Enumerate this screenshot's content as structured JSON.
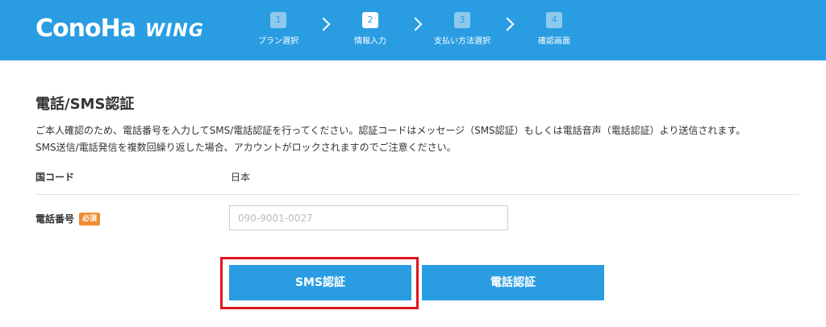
{
  "header": {
    "logo_main": "ConoHa",
    "logo_sub": "WING",
    "bg_color": "#2a9de2"
  },
  "steps": [
    {
      "num": "1",
      "label": "プラン選択",
      "active": false
    },
    {
      "num": "2",
      "label": "情報入力",
      "active": true
    },
    {
      "num": "3",
      "label": "支払い方法選択",
      "active": false
    },
    {
      "num": "4",
      "label": "確認画面",
      "active": false
    }
  ],
  "main": {
    "title": "電話/SMS認証",
    "description_line1": "ご本人確認のため、電話番号を入力してSMS/電話認証を行ってください。認証コードはメッセージ（SMS認証）もしくは電話音声（電話認証）より送信されます。",
    "description_line2": "SMS送信/電話発信を複数回繰り返した場合、アカウントがロックされますのでご注意ください。",
    "country_label": "国コード",
    "country_value": "日本",
    "phone_label": "電話番号",
    "required_badge": "必須",
    "phone_value": "090-9001-0027",
    "sms_button": "SMS認証",
    "tel_button": "電話認証"
  },
  "colors": {
    "accent": "#2a9de2",
    "badge": "#f08c33",
    "highlight": "#e0141e"
  }
}
